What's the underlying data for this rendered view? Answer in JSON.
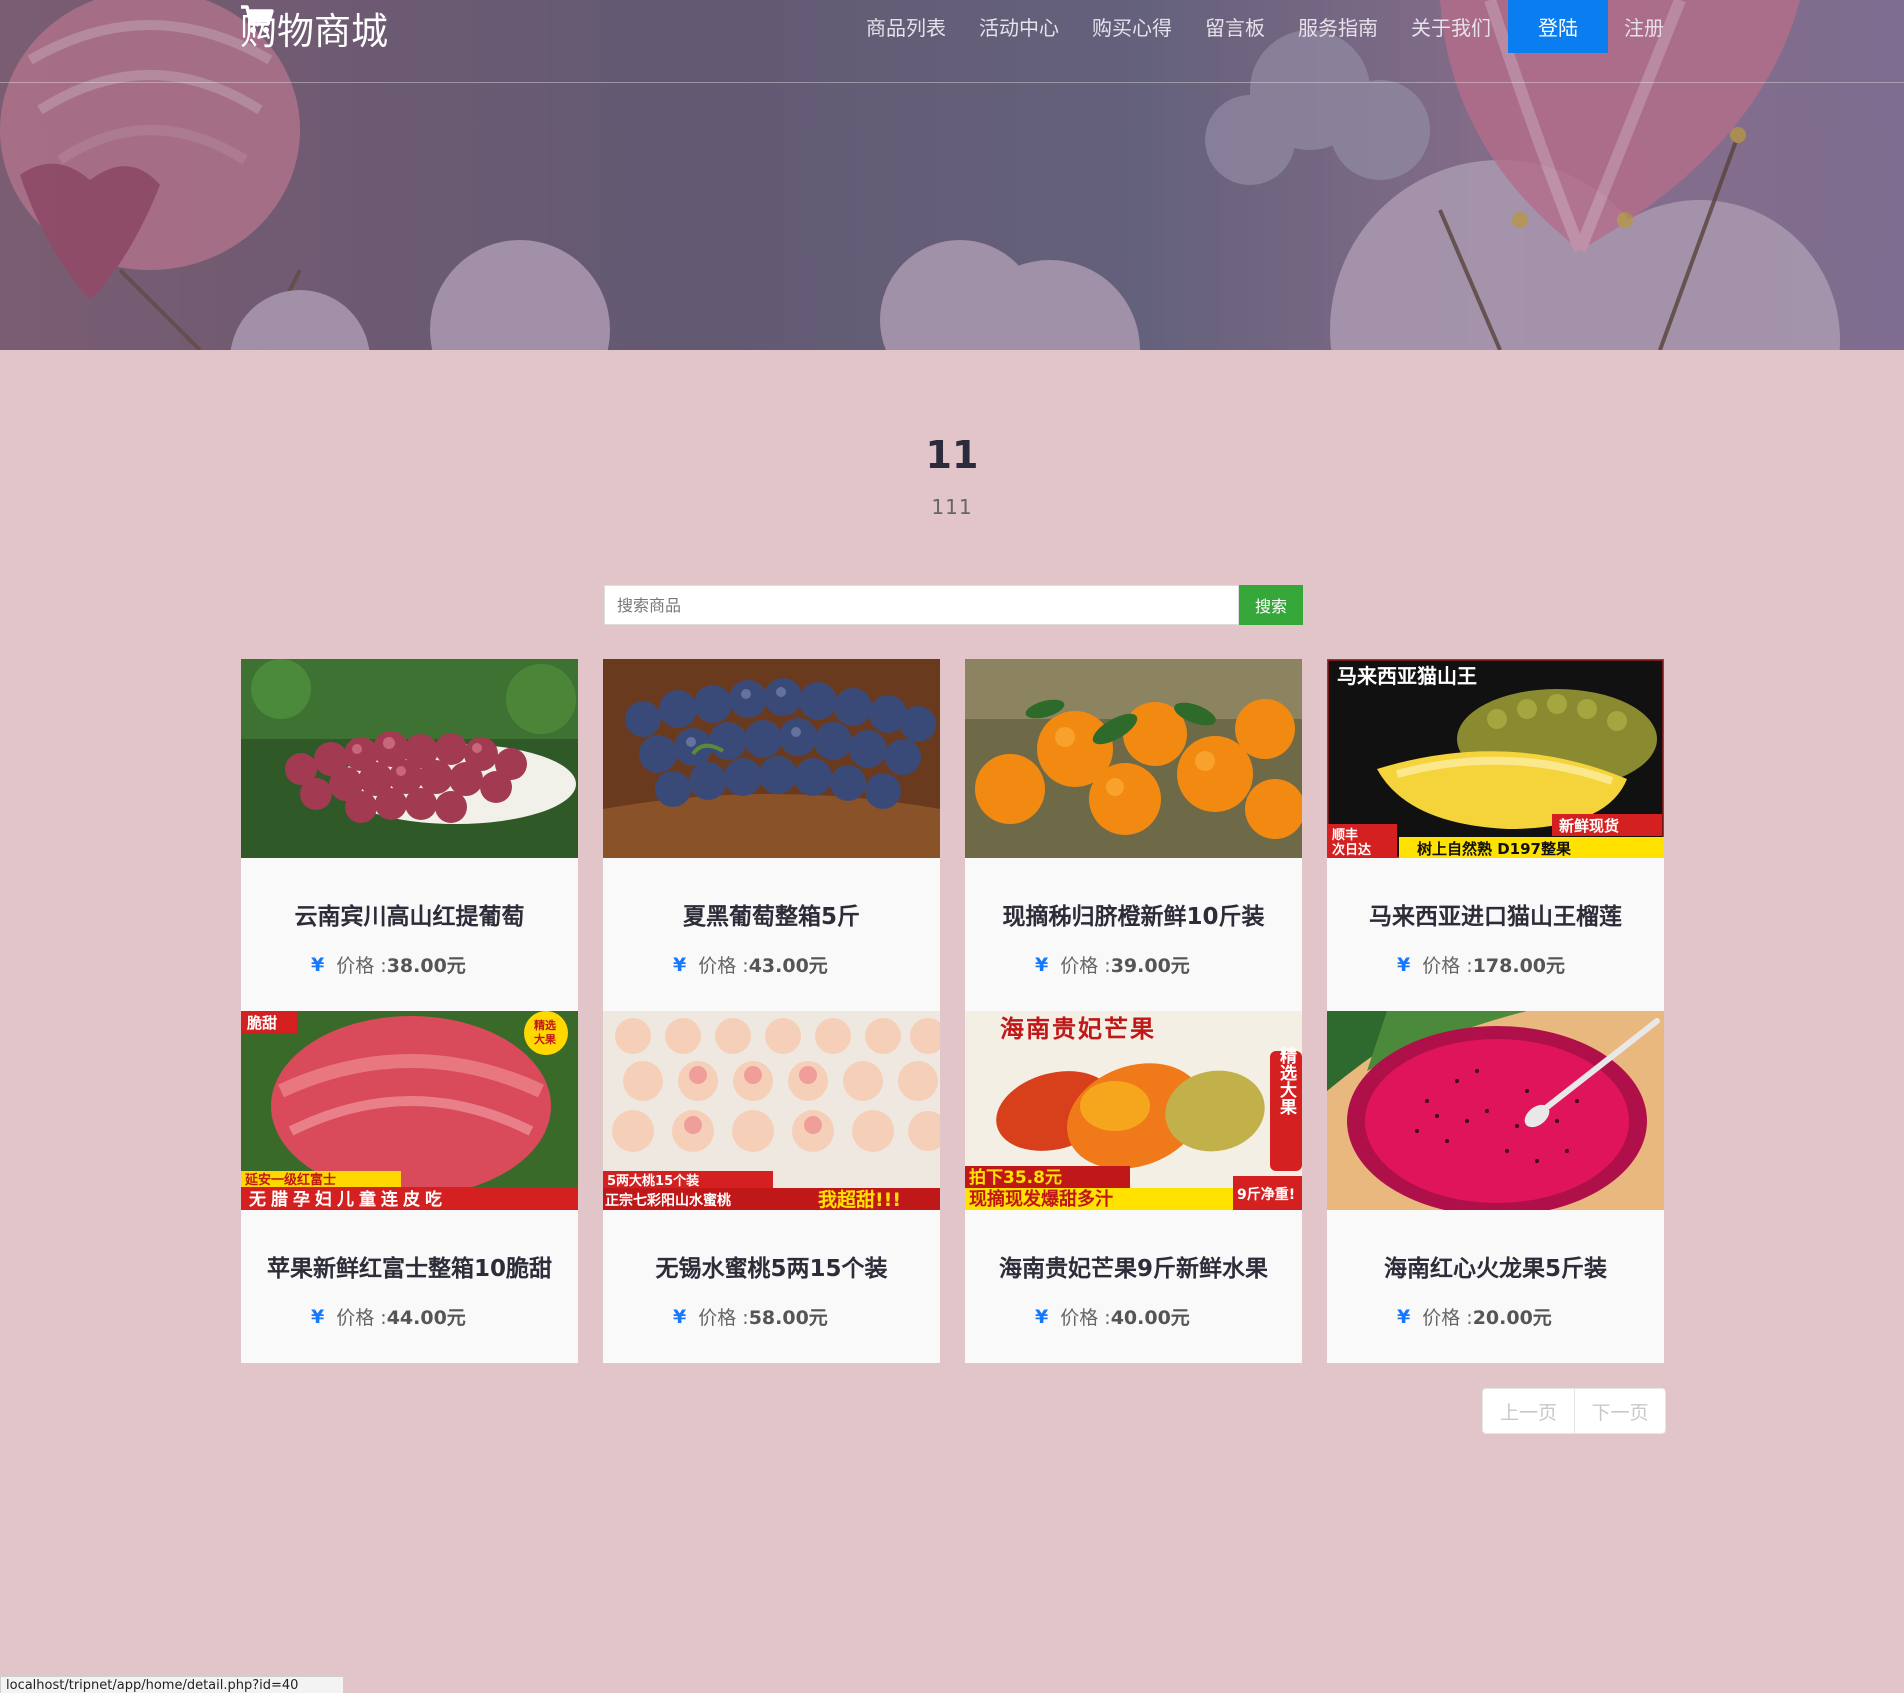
{
  "header": {
    "brand": "购物商城",
    "nav": [
      "商品列表",
      "活动中心",
      "购买心得",
      "留言板",
      "服务指南",
      "关于我们"
    ],
    "login": "登陆",
    "register": "注册"
  },
  "section": {
    "title": "11",
    "subtitle": "111"
  },
  "search": {
    "placeholder": "搜索商品",
    "button": "搜索"
  },
  "products": [
    {
      "title": "云南宾川高山红提葡萄",
      "price_label": "价格 : ",
      "price": "38.00元",
      "image": "red-grapes"
    },
    {
      "title": "夏黑葡萄整箱5斤",
      "price_label": "价格 : ",
      "price": "43.00元",
      "image": "black-grapes"
    },
    {
      "title": "现摘秭归脐橙新鲜10斤装",
      "price_label": "价格 : ",
      "price": "39.00元",
      "image": "navel-oranges"
    },
    {
      "title": "马来西亚进口猫山王榴莲",
      "price_label": "价格 : ",
      "price": "178.00元",
      "image": "durian"
    },
    {
      "title": "苹果新鲜红富士整箱10脆甜",
      "price_label": "价格 : ",
      "price": "44.00元",
      "image": "fuji-apple"
    },
    {
      "title": "无锡水蜜桃5两15个装",
      "price_label": "价格 : ",
      "price": "58.00元",
      "image": "peaches"
    },
    {
      "title": "海南贵妃芒果9斤新鲜水果",
      "price_label": "价格 : ",
      "price": "40.00元",
      "image": "mangoes"
    },
    {
      "title": "海南红心火龙果5斤装",
      "price_label": "价格 : ",
      "price": "20.00元",
      "image": "dragon-fruit"
    }
  ],
  "image_text": {
    "durian_top": "马来西亚猫山王",
    "durian_tag1": "新鲜现货",
    "durian_tag2": "顺丰",
    "durian_tag3": "次日达",
    "durian_bottom": "树上自然熟 D197整果",
    "apple_tl": "脆甜",
    "apple_tr1": "精选",
    "apple_tr2": "大果",
    "apple_b1": "延安一级红富士",
    "apple_b2": "无腊孕妇儿童连皮吃",
    "peach_b1": "5两大桃15个装",
    "peach_b2": "正宗七彩阳山水蜜桃",
    "peach_b3": "我超甜!!!",
    "mango_top": "海南贵妃芒果",
    "mango_side": "精选大果",
    "mango_b1": "拍下35.8元",
    "mango_b2": "现摘现发爆甜多汁",
    "mango_b3": "9斤净重!"
  },
  "pagination": {
    "prev": "上一页",
    "next": "下一页"
  },
  "statusbar": "localhost/tripnet/app/home/detail.php?id=40",
  "colors": {
    "page_bg": "#e2c5c8",
    "login_bg": "#0a7df0",
    "search_btn": "#36a83a",
    "price_icon": "#1677ff"
  }
}
